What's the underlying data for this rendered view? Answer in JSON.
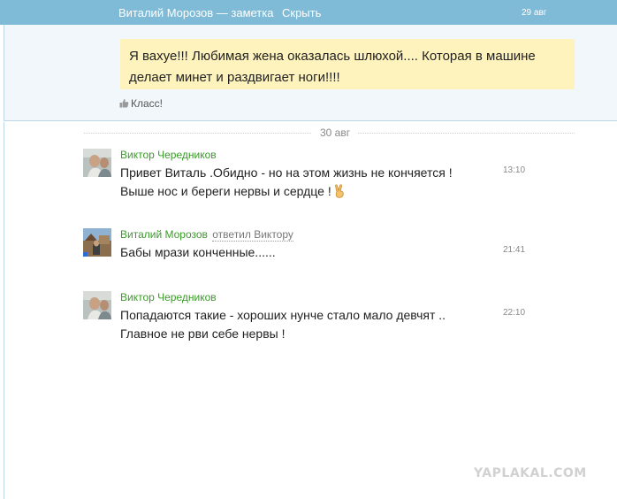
{
  "header": {
    "title": "Виталий Морозов — заметка",
    "hide_label": "Скрыть",
    "date": "29 авг"
  },
  "note": {
    "lines": [
      "Я вахуе!!! Любимая жена оказалась шлюхой.... Которая в машине",
      "делает минет и   раздвигает ноги!!!!"
    ],
    "like_label": "Класс!",
    "like_icon": "thumbs-up-icon"
  },
  "conversation": {
    "date_separator": "30 авг",
    "messages": [
      {
        "author": "Виктор Чередников",
        "reply_note": "",
        "lines": [
          "Привет  Виталь .Обидно - но на этом жизнь не кончяется !",
          "Выше нос  и береги нервы и сердце !"
        ],
        "emoji": "victory-hand-icon",
        "time": "13:10"
      },
      {
        "author": "Виталий Морозов",
        "reply_note": "ответил Виктору",
        "lines": [
          "Бабы мрази конченные......"
        ],
        "emoji": "",
        "time": "21:41"
      },
      {
        "author": "Виктор Чередников",
        "reply_note": "",
        "lines": [
          "Попадаются такие -  хороших  нунче  стало  мало  девчят ..",
          "Главное  не рви себе нервы !"
        ],
        "emoji": "",
        "time": "22:10"
      }
    ]
  },
  "watermark": "YAPLAKAL.COM",
  "colors": {
    "top_bar": "#7fbad6",
    "note_background": "#fff3bd",
    "author_green": "#3a9b28",
    "panel_background": "#f1f7fb"
  }
}
